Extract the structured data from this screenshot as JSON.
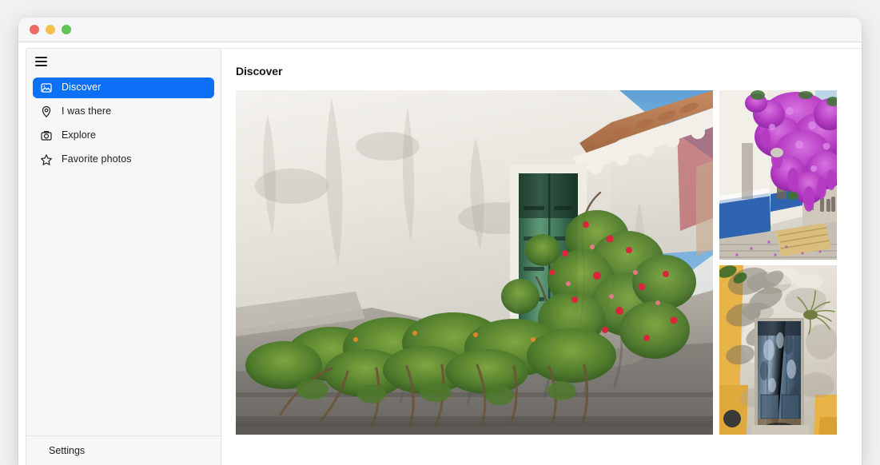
{
  "window": {
    "traffic_lights": [
      {
        "name": "close",
        "color": "#ec6a5f"
      },
      {
        "name": "minimize",
        "color": "#f3bf4f"
      },
      {
        "name": "zoom",
        "color": "#61c554"
      }
    ]
  },
  "theme": {
    "accent": "#0b70f5",
    "page_bg": "#f2f1ef",
    "sidebar_bg": "#f7f7f7",
    "content_bg": "#ffffff",
    "text": "#1e1e1e",
    "divider": "#e2e2e2"
  },
  "sidebar": {
    "menu_toggle_icon": "hamburger-icon",
    "items": [
      {
        "label": "Discover",
        "icon": "photo-icon",
        "active": true
      },
      {
        "label": "I was there",
        "icon": "map-pin-icon",
        "active": false
      },
      {
        "label": "Explore",
        "icon": "camera-icon",
        "active": false
      },
      {
        "label": "Favorite photos",
        "icon": "star-icon",
        "active": false
      }
    ],
    "footer": {
      "label": "Settings",
      "icon": "gear-icon"
    }
  },
  "main": {
    "title": "Discover",
    "gallery": {
      "hero": {
        "name": "whitewashed-house-green-door",
        "alt": "Whitewashed stone house with a weathered green wooden door, terracotta roof tiles and climbing bougainvillea with red flowers over a grey stone wall"
      },
      "thumbnails": [
        {
          "name": "purple-bougainvillea-street",
          "alt": "Narrow white and blue painted village street overhung with bright magenta bougainvillea blossoms"
        },
        {
          "name": "weathered-blue-door",
          "alt": "Old weathered blue-grey wooden door set in a peeling white and yellow plaster wall"
        }
      ]
    }
  }
}
